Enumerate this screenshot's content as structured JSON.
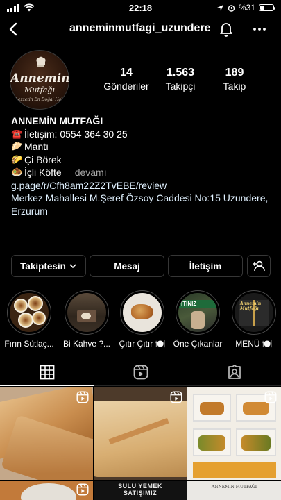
{
  "status_bar": {
    "time": "22:18",
    "battery": "%31",
    "battery_level": 0.31
  },
  "header": {
    "username": "anneminmutfagi_uzundere"
  },
  "avatar": {
    "line1": "Annemin",
    "line2": "Mutfağı",
    "line3": "Lezzetin En Doğal Hali"
  },
  "stats": [
    {
      "value": "14",
      "label": "Gönderiler"
    },
    {
      "value": "1.563",
      "label": "Takipçi"
    },
    {
      "value": "189",
      "label": "Takip"
    }
  ],
  "bio": {
    "name": "ANNEMİN MUTFAĞI",
    "lines": [
      {
        "emoji": "☎️",
        "text": "İletişim: 0554 364 30 25"
      },
      {
        "emoji": "🥟",
        "text": "Mantı"
      },
      {
        "emoji": "🌮",
        "text": "Çi Börek"
      },
      {
        "emoji": "🧆",
        "text": "İçli Köfte"
      }
    ],
    "more": "devamı",
    "link": "g.page/r/Cfh8am22Z2TvEBE/review",
    "address": "Merkez Mahallesi M.Şeref Özsoy Caddesi No:15 Uzundere, Erzurum"
  },
  "buttons": {
    "follow": "Takiptesin",
    "message": "Mesaj",
    "contact": "İletişim"
  },
  "highlights": [
    {
      "label": "Fırın Sütlaç..."
    },
    {
      "label": "Bi Kahve ?..."
    },
    {
      "label": "Çıtır Çıtır 🍽️"
    },
    {
      "label": "Öne Çıkanlar"
    },
    {
      "label": "MENÜ 🍽️"
    }
  ],
  "highlight_texts": {
    "ititiniz": "ITINIZ",
    "menu_brand": "Annemin Mutfağı"
  },
  "grid_texts": {
    "sulu": "SULU YEMEK",
    "satis": "SATIŞIMIZ",
    "brand": "ANNEMİN MUTFAĞI"
  }
}
